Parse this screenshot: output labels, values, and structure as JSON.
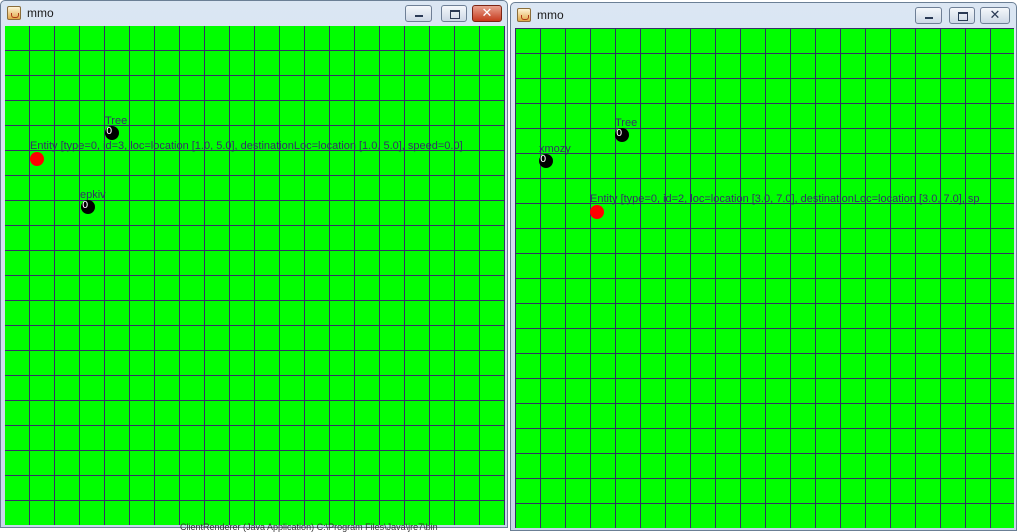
{
  "colors": {
    "canvas_bg": "#00ff00",
    "grid_line": "#333366",
    "player": "#ff0000",
    "entity": "#000000"
  },
  "windows": [
    {
      "title": "mmo",
      "app_icon": "java-coffee-icon",
      "entities": [
        {
          "name": "Tree",
          "counter": "0",
          "kind": "black"
        },
        {
          "name": "Entity [type=0, id=3, loc=location [1.0, 5.0], destinationLoc=location [1.0, 5.0], speed=0.0]",
          "counter": "",
          "kind": "red"
        },
        {
          "name": "epkiv",
          "counter": "0",
          "kind": "black"
        }
      ]
    },
    {
      "title": "mmo",
      "app_icon": "java-coffee-icon",
      "entities": [
        {
          "name": "Tree",
          "counter": "0",
          "kind": "black"
        },
        {
          "name": "xmozy",
          "counter": "0",
          "kind": "black"
        },
        {
          "name": "Entity [type=0, id=2, loc=location [3.0, 7.0], destinationLoc=location [3.0, 7.0], sp",
          "counter": "",
          "kind": "red"
        }
      ]
    }
  ],
  "background_text": "ClientRenderer (Java Application) C:\\Program Files\\Java\\jre7\\bin"
}
